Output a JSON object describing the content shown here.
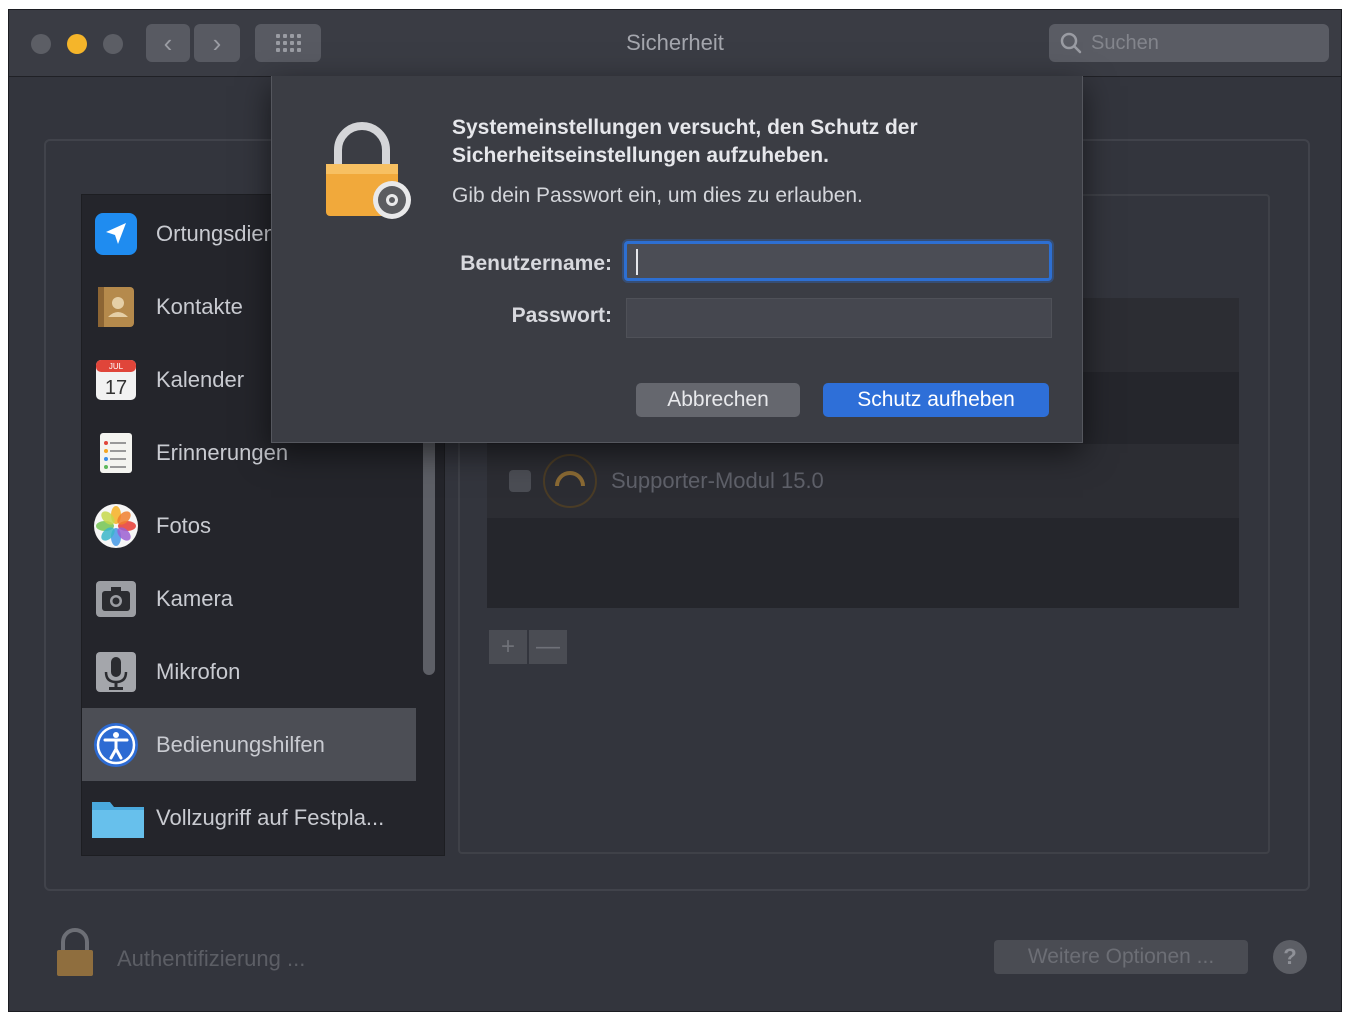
{
  "window": {
    "title": "Sicherheit",
    "search_placeholder": "Suchen"
  },
  "sidebar": {
    "items": [
      {
        "label": "Ortungsdienste",
        "icon": "location-arrow-icon"
      },
      {
        "label": "Kontakte",
        "icon": "contacts-book-icon"
      },
      {
        "label": "Kalender",
        "icon": "calendar-icon",
        "date": "17",
        "month": "JUL"
      },
      {
        "label": "Erinnerungen",
        "icon": "reminders-list-icon"
      },
      {
        "label": "Fotos",
        "icon": "photos-flower-icon"
      },
      {
        "label": "Kamera",
        "icon": "camera-icon"
      },
      {
        "label": "Mikrofon",
        "icon": "microphone-icon"
      },
      {
        "label": "Bedienungshilfen",
        "icon": "accessibility-icon",
        "selected": true
      },
      {
        "label": "Vollzugriff auf Festpla...",
        "icon": "folder-icon"
      }
    ]
  },
  "applist": {
    "items": [
      {
        "label": "Supporter-Modul 15.0",
        "checked": false,
        "icon": "supporter-module-icon"
      }
    ],
    "add_label": "+",
    "remove_label": "—"
  },
  "footer": {
    "auth_label": "Authentifizierung ...",
    "more_options_label": "Weitere Optionen ...",
    "help_label": "?"
  },
  "dialog": {
    "title": "Systemeinstellungen versucht, den Schutz der Sicherheitseinstellungen aufzuheben.",
    "subtitle": "Gib dein Passwort ein, um dies zu erlauben.",
    "username_label": "Benutzername:",
    "username_value": "",
    "password_label": "Passwort:",
    "password_value": "",
    "cancel_label": "Abbrechen",
    "unlock_label": "Schutz aufheben"
  },
  "colors": {
    "accent": "#2e6fd8",
    "window_bg": "#33353d",
    "traffic_yellow": "#f5b52a"
  }
}
